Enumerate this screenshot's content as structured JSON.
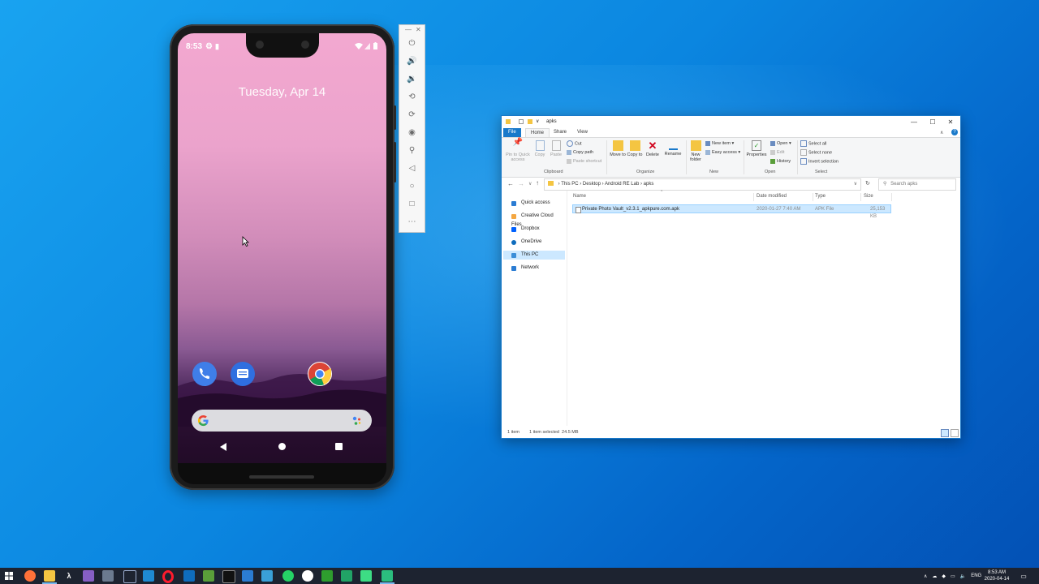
{
  "phone": {
    "status_time": "8:53",
    "date": "Tuesday, Apr 14",
    "dock_apps": [
      "phone-app",
      "messages-app",
      "chrome-app"
    ]
  },
  "emulator_toolbar": {
    "buttons": [
      "power",
      "volume-up",
      "volume-down",
      "rotate-left",
      "rotate-right",
      "screenshot",
      "zoom",
      "back",
      "home",
      "overview",
      "more"
    ]
  },
  "explorer": {
    "title": "apks",
    "tabs": [
      "File",
      "Home",
      "Share",
      "View"
    ],
    "ribbon": {
      "clipboard": {
        "label": "Clipboard",
        "pin": "Pin to Quick access",
        "copy": "Copy",
        "paste": "Paste",
        "cut": "Cut",
        "copy_path": "Copy path",
        "paste_shortcut": "Paste shortcut"
      },
      "organize": {
        "label": "Organize",
        "move_to": "Move to",
        "copy_to": "Copy to",
        "delete": "Delete",
        "rename": "Rename"
      },
      "new": {
        "label": "New",
        "new_folder": "New folder",
        "new_item": "New item",
        "easy_access": "Easy access"
      },
      "open": {
        "label": "Open",
        "properties": "Properties",
        "open": "Open",
        "edit": "Edit",
        "history": "History"
      },
      "select": {
        "label": "Select",
        "select_all": "Select all",
        "select_none": "Select none",
        "invert_selection": "Invert selection"
      }
    },
    "breadcrumb": [
      "This PC",
      "Desktop",
      "Android RE Lab",
      "apks"
    ],
    "search_placeholder": "Search apks",
    "nav_items": [
      "Quick access",
      "Creative Cloud Files",
      "Dropbox",
      "OneDrive",
      "This PC",
      "Network"
    ],
    "columns": [
      "Name",
      "Date modified",
      "Type",
      "Size"
    ],
    "files": [
      {
        "name": "Private Photo Vault_v2.3.1_apkpure.com.apk",
        "date": "2020-01-27 7:40 AM",
        "type": "APK File",
        "size": "25,153 KB"
      }
    ],
    "status": {
      "count": "1 item",
      "selected": "1 item selected  24.5 MB"
    }
  },
  "taskbar": {
    "lang": "ENG",
    "time": "8:53 AM",
    "date": "2020-04-14"
  },
  "colors": {
    "explorer_accent": "#1979ca",
    "selection": "#cce8ff",
    "taskbar": "#1d2330"
  }
}
